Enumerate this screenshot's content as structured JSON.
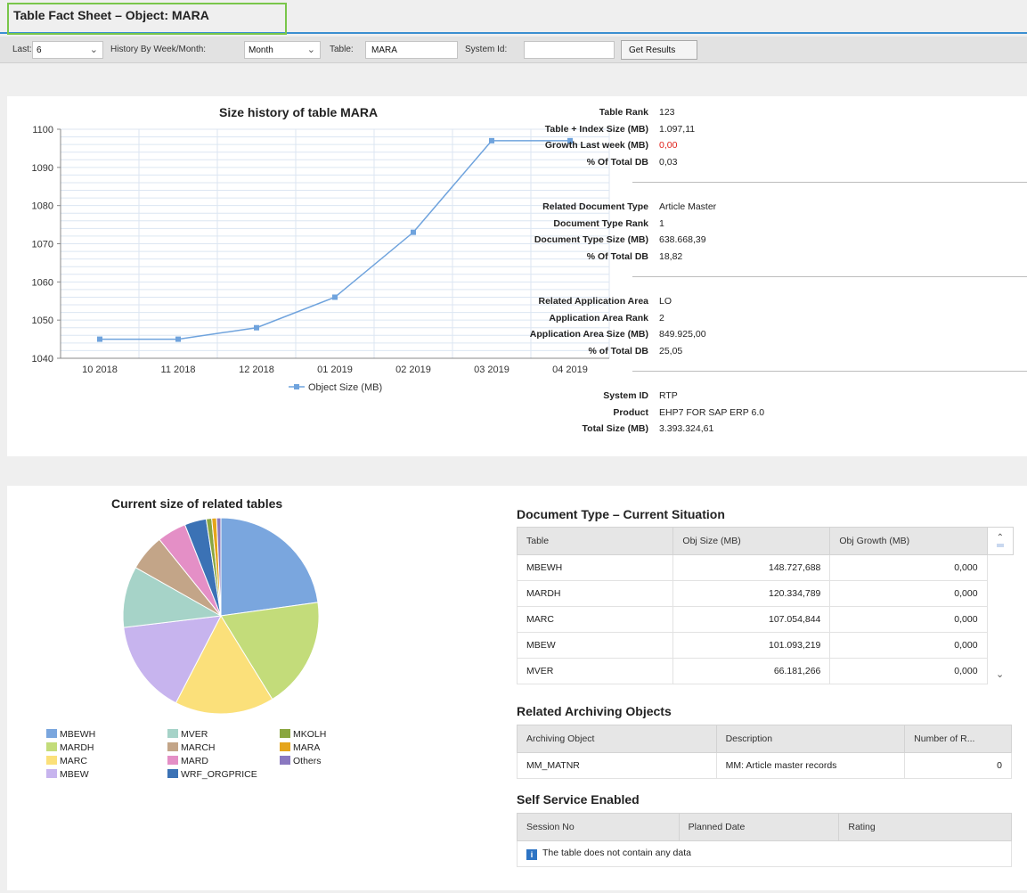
{
  "page": {
    "title": "Table Fact Sheet – Object: MARA"
  },
  "toolbar": {
    "last_label": "Last:",
    "last_value": "6",
    "history_label": "History By Week/Month:",
    "history_value": "Month",
    "table_label": "Table:",
    "table_value": "MARA",
    "system_label": "System Id:",
    "system_value": "",
    "get_results": "Get Results"
  },
  "chart_data": [
    {
      "type": "line",
      "title": "Size history of table MARA",
      "categories": [
        "10 2018",
        "11 2018",
        "12 2018",
        "01 2019",
        "02 2019",
        "03 2019",
        "04 2019"
      ],
      "series": [
        {
          "name": "Object Size (MB)",
          "values": [
            1045,
            1045,
            1048,
            1056,
            1073,
            1097,
            1097
          ]
        }
      ],
      "ylim": [
        1040,
        1100
      ],
      "yticks": [
        "1040",
        "1050",
        "1060",
        "1070",
        "1080",
        "1090",
        "1100"
      ],
      "grid": true,
      "legend": "bottom",
      "color": "#6fa3dd"
    },
    {
      "type": "pie",
      "title": "Current size of related tables",
      "slices": [
        {
          "label": "MBEWH",
          "value": 22.8,
          "color": "#7aa6de"
        },
        {
          "label": "MARDH",
          "value": 18.4,
          "color": "#c3dc7a"
        },
        {
          "label": "MARC",
          "value": 16.4,
          "color": "#fbe07a"
        },
        {
          "label": "MBEW",
          "value": 15.5,
          "color": "#c7b4ee"
        },
        {
          "label": "MVER",
          "value": 10.1,
          "color": "#a6d3c8"
        },
        {
          "label": "MARCH",
          "value": 6.0,
          "color": "#c3a588"
        },
        {
          "label": "MARD",
          "value": 4.8,
          "color": "#e48fc6"
        },
        {
          "label": "WRF_ORGPRICE",
          "value": 3.6,
          "color": "#3b72b5"
        },
        {
          "label": "MKOLH",
          "value": 0.9,
          "color": "#8aa640"
        },
        {
          "label": "MARA",
          "value": 0.8,
          "color": "#e5a51c"
        },
        {
          "label": "Others",
          "value": 0.7,
          "color": "#8a78c0"
        }
      ],
      "legend": "bottom"
    }
  ],
  "facts": [
    {
      "rows": [
        {
          "label": "Table Rank",
          "value": "123"
        },
        {
          "label": "Table + Index Size (MB)",
          "value": "1.097,11"
        },
        {
          "label": "Growth Last week (MB)",
          "value": "0,00",
          "highlight": "#e0201a"
        },
        {
          "label": "% Of Total DB",
          "value": "0,03"
        }
      ]
    },
    {
      "rows": [
        {
          "label": "Related Document Type",
          "value": "Article Master"
        },
        {
          "label": "Document Type Rank",
          "value": "1"
        },
        {
          "label": "Document Type Size (MB)",
          "value": "638.668,39"
        },
        {
          "label": "% Of Total DB",
          "value": "18,82"
        }
      ]
    },
    {
      "rows": [
        {
          "label": "Related Application Area",
          "value": "LO"
        },
        {
          "label": "Application Area Rank",
          "value": "2"
        },
        {
          "label": "Application Area Size (MB)",
          "value": "849.925,00"
        },
        {
          "label": "% of Total DB",
          "value": "25,05"
        }
      ]
    },
    {
      "rows": [
        {
          "label": "System ID",
          "value": "RTP"
        },
        {
          "label": "Product",
          "value": "EHP7 FOR SAP ERP 6.0"
        },
        {
          "label": "Total Size (MB)",
          "value": "3.393.324,61"
        }
      ]
    }
  ],
  "doc_type": {
    "title": "Document Type – Current Situation",
    "headers": [
      "Table",
      "Obj Size (MB)",
      "Obj Growth (MB)"
    ],
    "rows": [
      [
        "MBEWH",
        "148.727,688",
        "0,000"
      ],
      [
        "MARDH",
        "120.334,789",
        "0,000"
      ],
      [
        "MARC",
        "107.054,844",
        "0,000"
      ],
      [
        "MBEW",
        "101.093,219",
        "0,000"
      ],
      [
        "MVER",
        "66.181,266",
        "0,000"
      ]
    ]
  },
  "archiving": {
    "title": "Related Archiving Objects",
    "headers": [
      "Archiving Object",
      "Description",
      "Number of R..."
    ],
    "rows": [
      [
        "MM_MATNR",
        "MM: Article master records",
        "0"
      ]
    ]
  },
  "self_service": {
    "title": "Self Service Enabled",
    "headers": [
      "Session No",
      "Planned Date",
      "Rating"
    ],
    "empty": "The table does not contain any data"
  }
}
